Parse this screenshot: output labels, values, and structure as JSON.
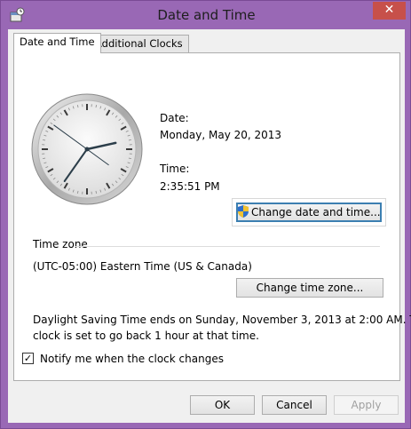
{
  "window": {
    "title": "Date and Time",
    "close_glyph": "✕"
  },
  "tabs": [
    {
      "label": "Date and Time",
      "active": true
    },
    {
      "label": "Additional Clocks",
      "active": false
    }
  ],
  "clock": {
    "hour": 2,
    "minute": 35,
    "second": 51
  },
  "date": {
    "label": "Date:",
    "value": "Monday, May 20, 2013"
  },
  "time": {
    "label": "Time:",
    "value": "2:35:51 PM"
  },
  "buttons": {
    "change_date_time": "Change date and time...",
    "change_time_zone": "Change time zone...",
    "ok": "OK",
    "cancel": "Cancel",
    "apply": "Apply"
  },
  "timezone": {
    "heading": "Time zone",
    "value": "(UTC-05:00) Eastern Time (US & Canada)"
  },
  "dst": {
    "line1": "Daylight Saving Time ends on Sunday, November 3, 2013 at 2:00 AM. The",
    "line2": "clock is set to go back 1 hour at that time."
  },
  "notify": {
    "label": "Notify me when the clock changes",
    "checked": true
  },
  "colors": {
    "window_frame": "#9968b5",
    "close_button": "#c7504a",
    "focus_border": "#3c7fb1"
  },
  "icons": {
    "app": "date-time-app-icon",
    "shield": "uac-shield-icon",
    "close": "close-icon"
  }
}
